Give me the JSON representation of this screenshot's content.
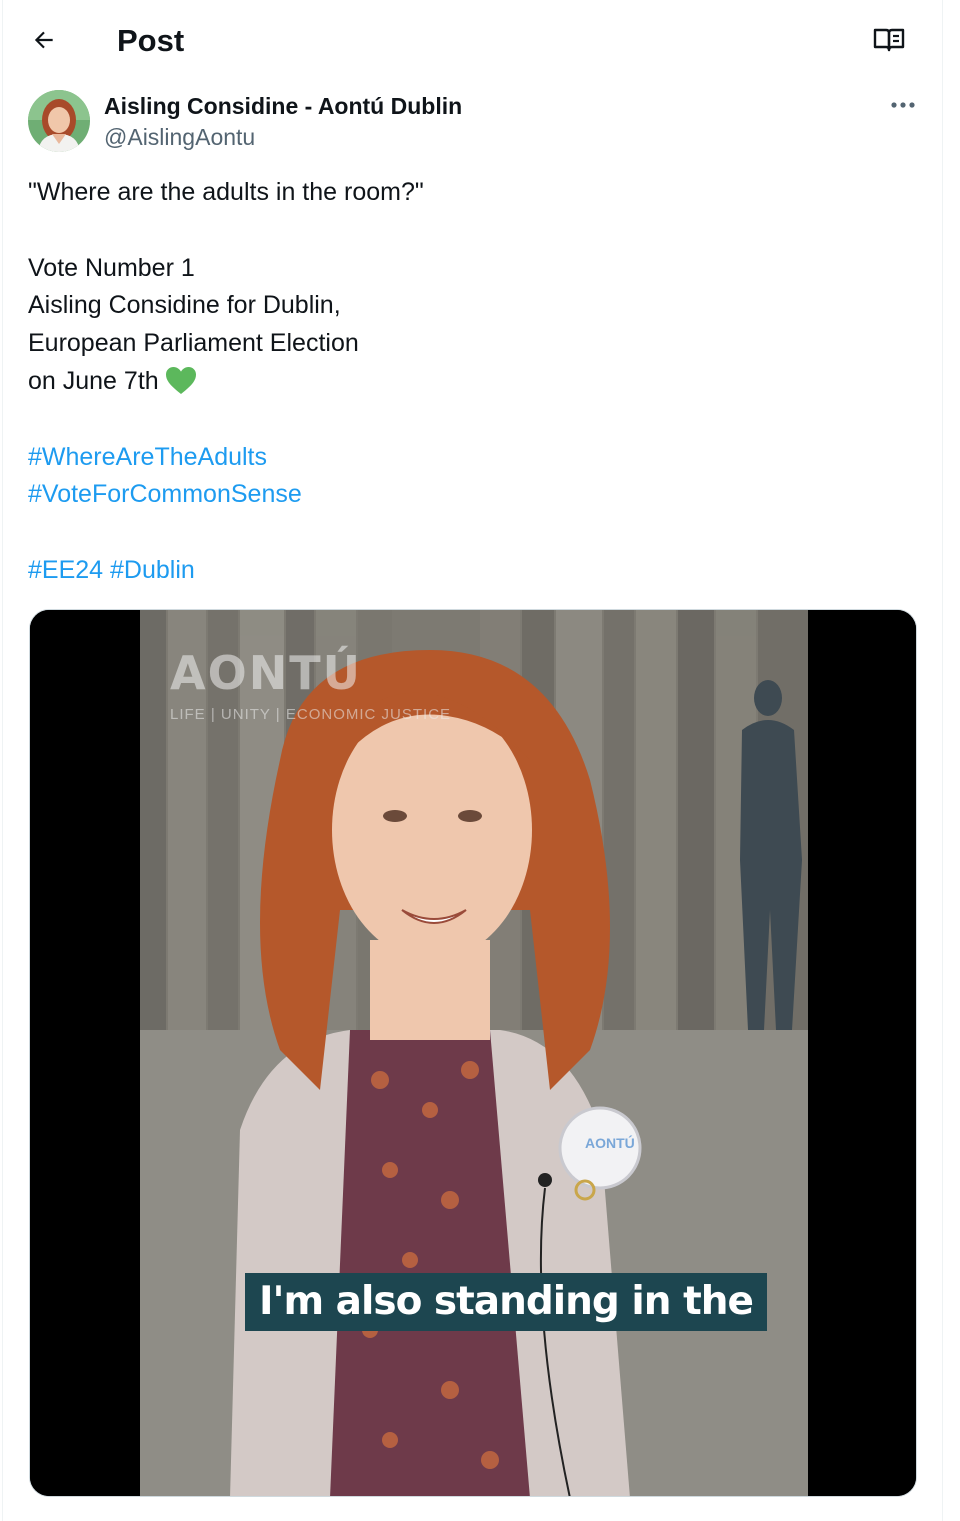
{
  "header": {
    "title": "Post",
    "back_icon": "arrow-left-icon",
    "reader_icon": "reader-mode-icon"
  },
  "author": {
    "display_name": "Aisling Considine - Aontú Dublin",
    "handle": "@AislingAontu",
    "more_icon": "more-horizontal-icon"
  },
  "tweet": {
    "line1": "\"Where are the adults in the room?\"",
    "line2": "Vote Number 1",
    "line3": "Aisling Considine for Dublin,",
    "line4": "European Parliament Election",
    "line5": "on June 7th",
    "emoji": "green-heart-icon",
    "hashtag1": "#WhereAreTheAdults",
    "hashtag2": "#VoteForCommonSense",
    "hashtag3": "#EE24",
    "hashtag4": "#Dublin"
  },
  "media": {
    "watermark": "AONTÚ",
    "watermark_tagline": "LIFE | UNITY | ECONOMIC JUSTICE",
    "caption": "I'm also standing in the",
    "badge": "AONTÚ"
  },
  "colors": {
    "link": "#1d9bf0",
    "secondary_text": "#536471",
    "heart": "#5cb85c",
    "caption_bg": "#1d4650"
  }
}
